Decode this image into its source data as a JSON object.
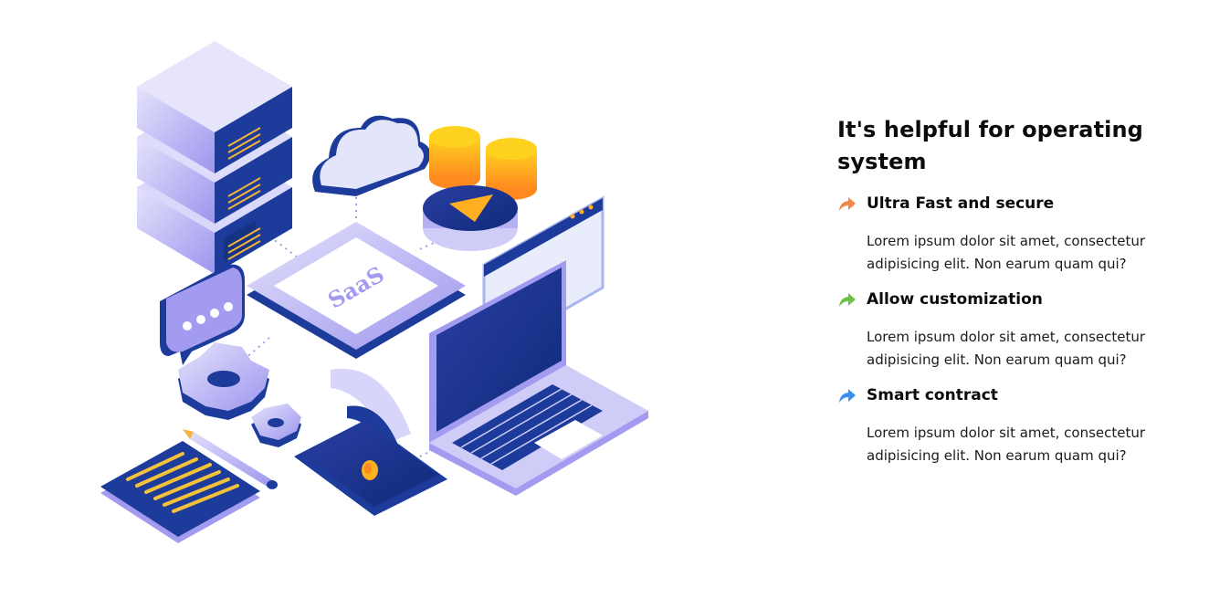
{
  "heading": "It's helpful for operating system",
  "illustration": {
    "center_label": "SaaS"
  },
  "features": [
    {
      "title": "Ultra Fast and secure",
      "description": "Lorem ipsum dolor sit amet, consectetur adipisicing elit. Non earum quam qui?",
      "icon": "share-arrow-icon",
      "color": "#f0884a"
    },
    {
      "title": "Allow customization",
      "description": "Lorem ipsum dolor sit amet, consectetur adipisicing elit. Non earum quam qui?",
      "icon": "share-arrow-icon",
      "color": "#6cc24a"
    },
    {
      "title": "Smart contract",
      "description": "Lorem ipsum dolor sit amet, consectetur adipisicing elit. Non earum quam qui?",
      "icon": "share-arrow-icon",
      "color": "#3b8ff0"
    }
  ]
}
